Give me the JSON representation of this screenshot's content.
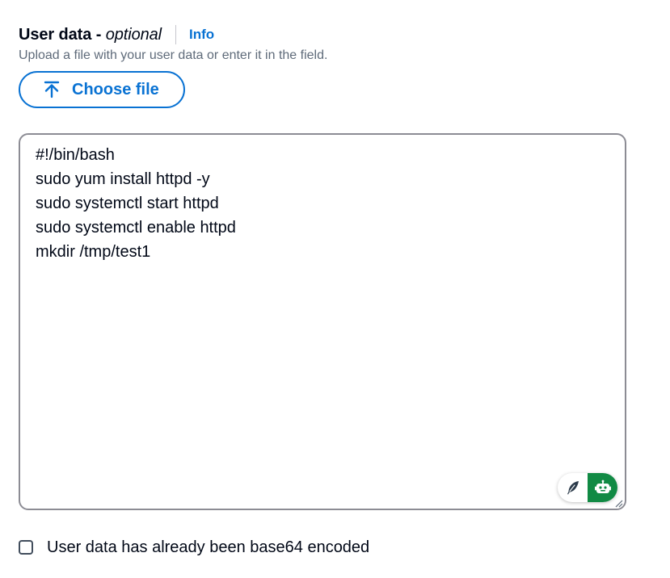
{
  "field": {
    "title": "User data -",
    "optional_label": "optional",
    "info_link": "Info",
    "description": "Upload a file with your user data or enter it in the field."
  },
  "upload": {
    "button_label": "Choose file",
    "icon": "upload-arrow-icon"
  },
  "editor": {
    "value": "#!/bin/bash\nsudo yum install httpd -y\nsudo systemctl start httpd\nsudo systemctl enable httpd\nmkdir /tmp/test1"
  },
  "extensions": {
    "icons": [
      "feather-icon",
      "robot-icon"
    ]
  },
  "base64_checkbox": {
    "label": "User data has already been base64 encoded",
    "checked": false
  },
  "colors": {
    "accent": "#0972d3",
    "text": "#000716",
    "muted": "#5f6b7a",
    "border": "#8c8c94",
    "extension_green": "#118a44"
  }
}
